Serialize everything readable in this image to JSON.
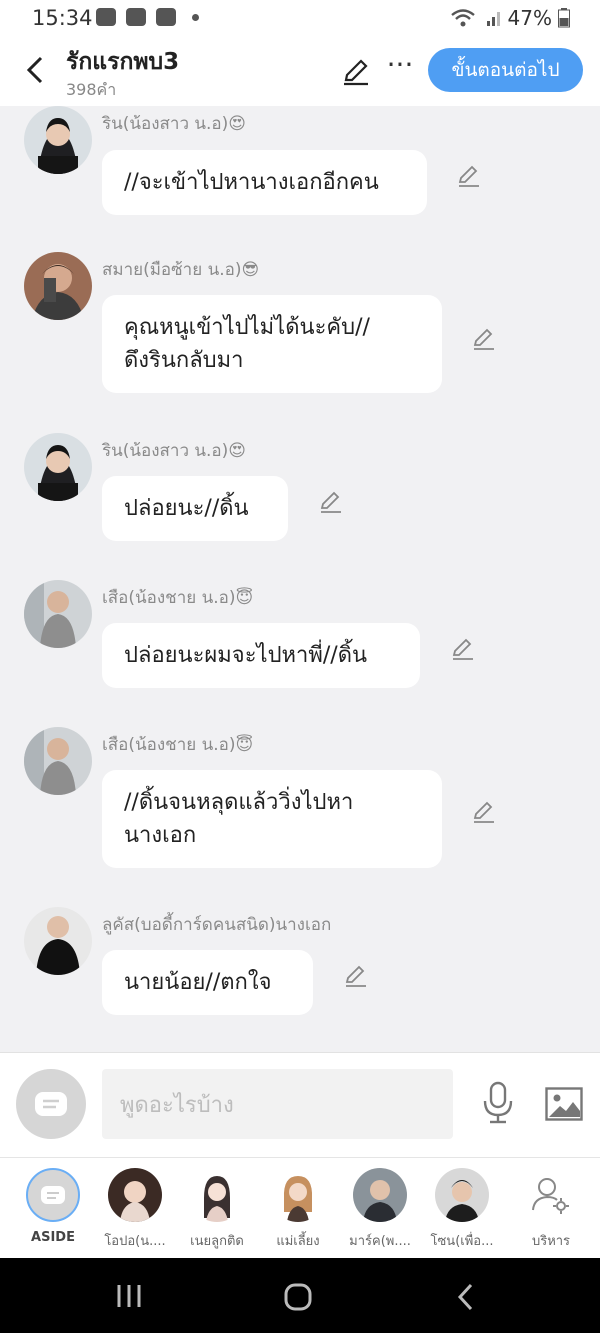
{
  "status": {
    "time": "15:34",
    "battery": "47%"
  },
  "header": {
    "title": "รักแรกพบ3",
    "word_count": "398คำ",
    "next_label": "ขั้นตอนต่อไป"
  },
  "messages": [
    {
      "speaker": "ริน(น้องสาว น.อ)😍",
      "text": "//จะเข้าไปหานางเอกอีกคน"
    },
    {
      "speaker": "สมาย(มือซ้าย น.อ)😎",
      "text": "คุณหนูเข้าไปไม่ได้นะคับ//\nดึงรินกลับมา"
    },
    {
      "speaker": "ริน(น้องสาว น.อ)😍",
      "text": "ปล่อยนะ//ดิ้น"
    },
    {
      "speaker": "เสือ(น้องชาย น.อ)😇",
      "text": "ปล่อยนะผมจะไปหาพี่//ดิ้น"
    },
    {
      "speaker": "เสือ(น้องชาย น.อ)😇",
      "text": "//ดิ้นจนหลุดแล้ววิ่งไปหา\nนางเอก"
    },
    {
      "speaker": "ลูคัส(บอดี้การ์ดคนสนิด)นางเอก",
      "text": "นายน้อย//ตกใจ"
    }
  ],
  "input": {
    "placeholder": "พูดอะไรบ้าง"
  },
  "characters": [
    {
      "label": "ASIDE"
    },
    {
      "label": "โอปอ(น...."
    },
    {
      "label": "เนยลูกติด"
    },
    {
      "label": "แม่เลี้ยง"
    },
    {
      "label": "มาร์ค(พ...."
    },
    {
      "label": "โซน(เพื่อ..."
    },
    {
      "label": "บริหาร"
    }
  ],
  "colors": {
    "accent": "#4f9ef3",
    "background": "#f1f1f3"
  }
}
